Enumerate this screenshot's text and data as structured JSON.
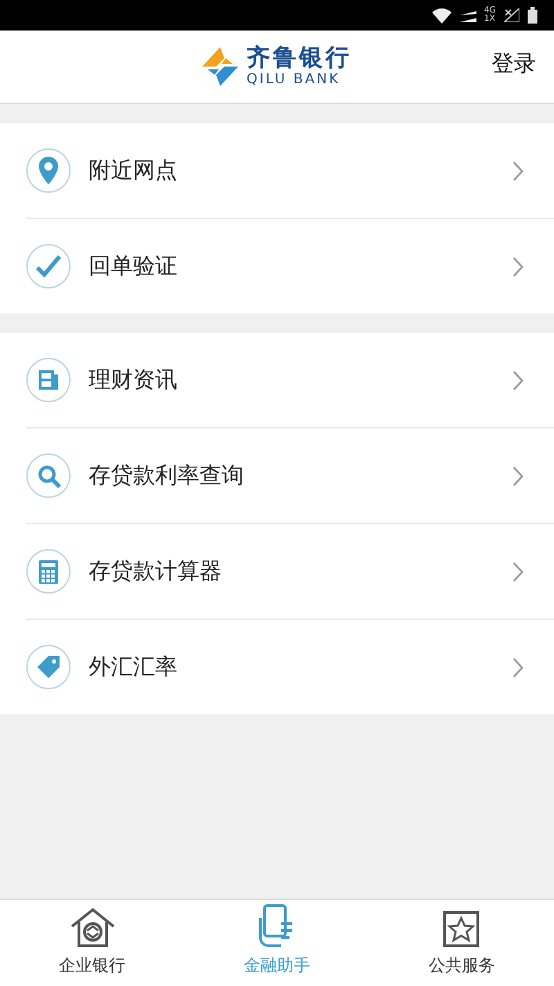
{
  "status_bar": {
    "network_top": "4G",
    "network_bottom": "1X"
  },
  "header": {
    "logo_title": "齐鲁银行",
    "logo_subtitle": "QILU BANK",
    "login": "登录"
  },
  "sections": [
    {
      "items": [
        {
          "kind": "pin",
          "label": "附近网点"
        },
        {
          "kind": "check",
          "label": "回单验证"
        }
      ]
    },
    {
      "items": [
        {
          "kind": "news",
          "label": "理财资讯"
        },
        {
          "kind": "search",
          "label": "存贷款利率查询"
        },
        {
          "kind": "calculator",
          "label": "存贷款计算器"
        },
        {
          "kind": "tag",
          "label": "外汇汇率"
        }
      ]
    }
  ],
  "tab_bar": [
    {
      "kind": "house",
      "label": "企业银行",
      "selected": false
    },
    {
      "kind": "phone",
      "label": "金融助手",
      "selected": true
    },
    {
      "kind": "star",
      "label": "公共服务",
      "selected": false
    }
  ]
}
